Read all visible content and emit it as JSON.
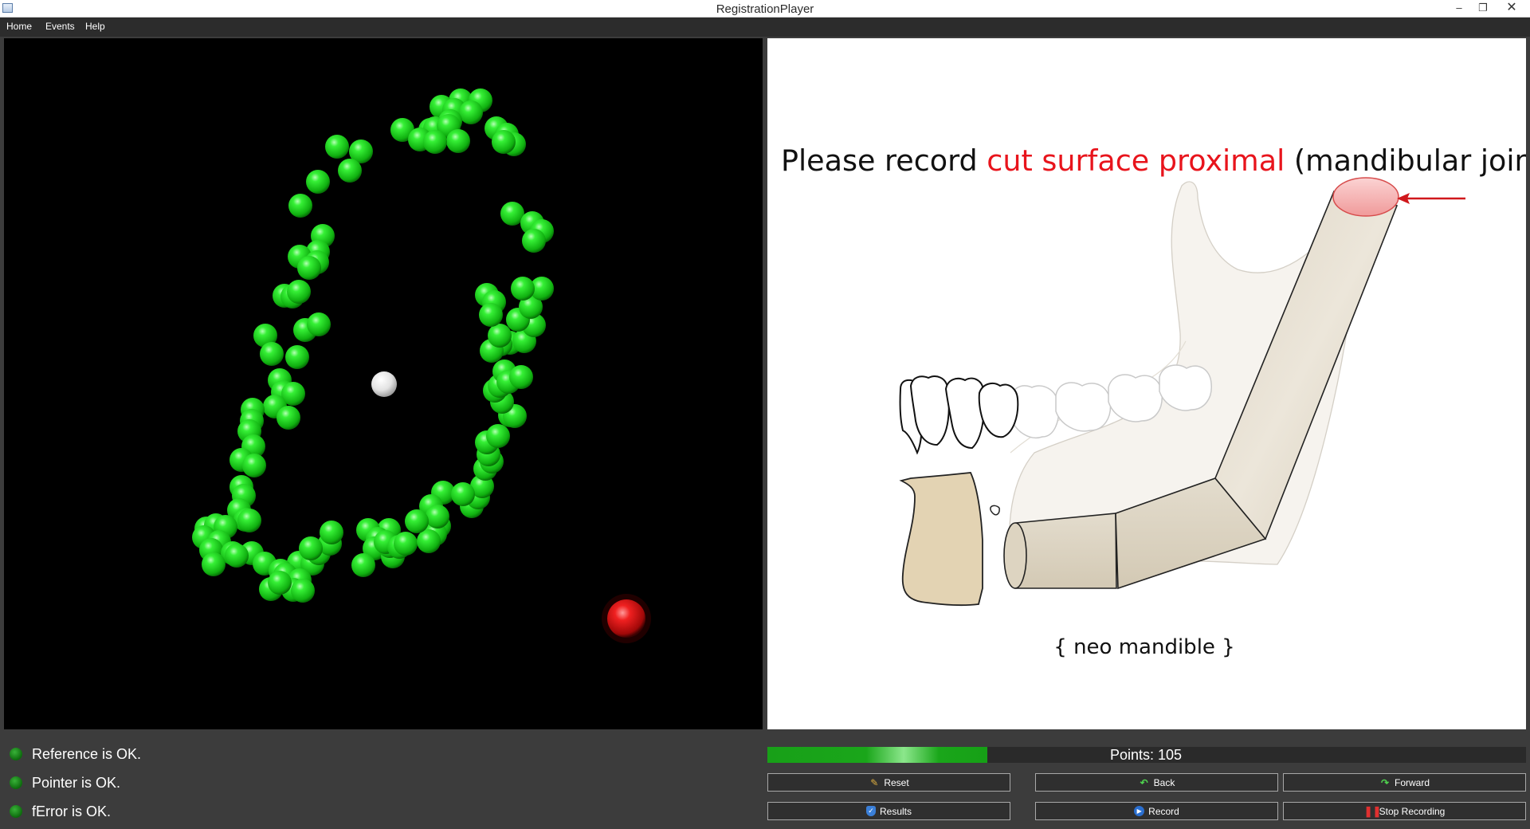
{
  "window": {
    "title": "RegistrationPlayer"
  },
  "menu": {
    "items": [
      "Home",
      "Events",
      "Help"
    ]
  },
  "instruction": {
    "prefix": "Please record ",
    "highlight": "cut surface proximal",
    "suffix": " (mandibular joint)",
    "caption": "{ neo mandible }",
    "highlight_color": "#e8141c"
  },
  "status": [
    {
      "label": "Reference is OK."
    },
    {
      "label": "Pointer is OK."
    },
    {
      "label": "fError is OK."
    }
  ],
  "progress": {
    "fraction": 0.29
  },
  "points": {
    "label": "Points: 105",
    "count": 105
  },
  "buttons": {
    "reset": {
      "label": "Reset",
      "icon": "broom-icon"
    },
    "back": {
      "label": "Back",
      "icon": "back-arrow-icon"
    },
    "forward": {
      "label": "Forward",
      "icon": "forward-arrow-icon"
    },
    "results": {
      "label": "Results",
      "icon": "shield-icon"
    },
    "record": {
      "label": "Record",
      "icon": "record-icon"
    },
    "stop": {
      "label": "Stop Recording",
      "icon": "stop-icon"
    }
  },
  "colors": {
    "point_green": "#22dd22",
    "pointer_red": "#dd1111",
    "reference_white": "#ffffff",
    "status_green": "#1a8a1a",
    "progress_green": "#1aa61a"
  }
}
